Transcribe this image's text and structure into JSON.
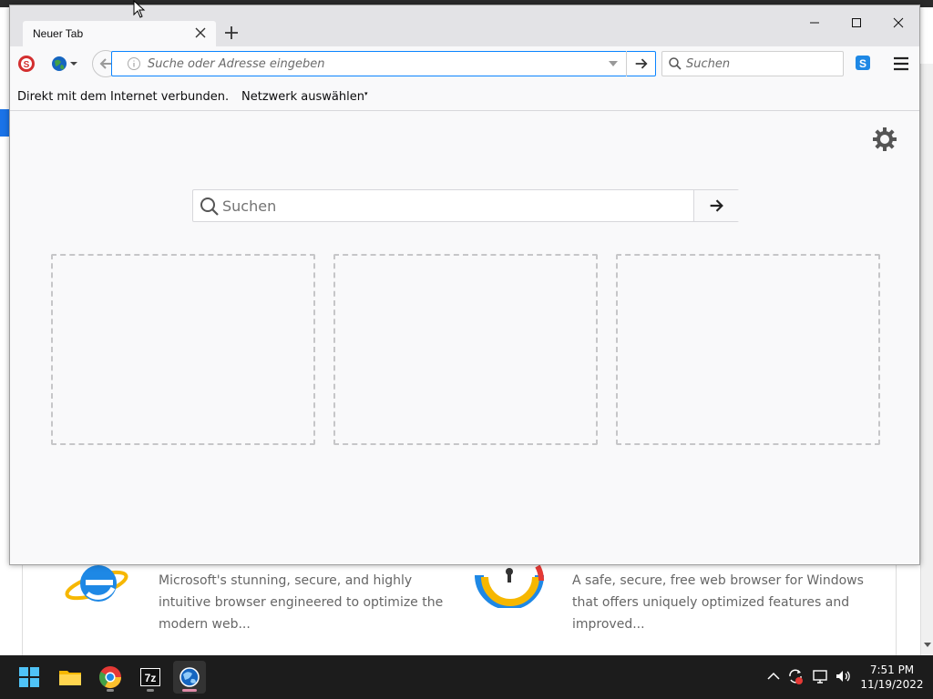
{
  "background_page": {
    "ie_description": "Microsoft's stunning, secure, and highly intuitive browser engineered to optimize the modern web...",
    "avast_description": "A safe, secure, free web browser for Windows that offers uniquely optimized features and improved..."
  },
  "browser": {
    "tab": {
      "title": "Neuer Tab"
    },
    "urlbar": {
      "placeholder": "Suche oder Adresse eingeben"
    },
    "searchbar": {
      "placeholder": "Suchen"
    },
    "infobar": {
      "status": "Direkt mit dem Internet verbunden.",
      "network_label": "Netzwerk auswählen"
    },
    "content": {
      "search_placeholder": "Suchen",
      "tiles": [
        "",
        "",
        ""
      ]
    }
  },
  "taskbar": {
    "icons": [
      "start-icon",
      "file-explorer-icon",
      "chrome-icon",
      "7zip-icon",
      "browser-app-icon"
    ],
    "clock": {
      "time": "7:51 PM",
      "date": "11/19/2022"
    }
  },
  "colors": {
    "accent": "#0a84ff",
    "taskbar": "#1c1c1c",
    "window_bg": "#f9f9fa",
    "tabbar_bg": "#e3e3e6"
  }
}
